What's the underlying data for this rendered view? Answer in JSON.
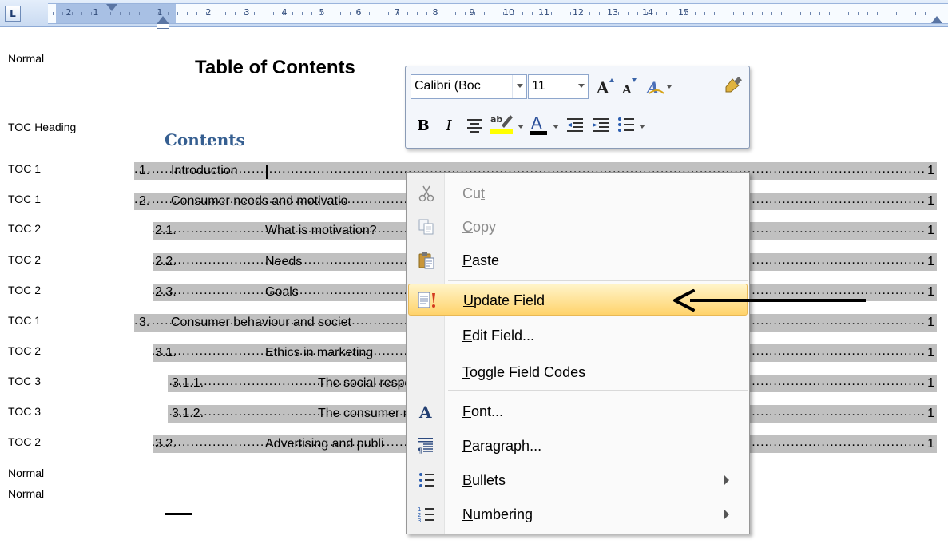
{
  "ruler": {
    "tab_selector": "L",
    "numbers": [
      "2",
      "1",
      "1",
      "2",
      "3",
      "4",
      "5",
      "6",
      "7",
      "8",
      "9",
      "10",
      "11",
      "12",
      "13",
      "14",
      "15"
    ]
  },
  "style_area": {
    "labels": [
      "Normal",
      "TOC Heading",
      "TOC 1",
      "TOC 1",
      "TOC 2",
      "TOC 2",
      "TOC 2",
      "TOC 1",
      "TOC 2",
      "TOC 3",
      "TOC 3",
      "TOC 2",
      "Normal",
      "Normal"
    ]
  },
  "document": {
    "title": "Table of Contents",
    "heading": "Contents",
    "toc": [
      {
        "num": "1.",
        "text": "Introduction",
        "page": "1"
      },
      {
        "num": "2.",
        "text": "Consumer needs and motivatio",
        "page": "1"
      },
      {
        "num": "2.1.",
        "text": "What is motivation?",
        "page": "1"
      },
      {
        "num": "2.2.",
        "text": "Needs",
        "page": "1"
      },
      {
        "num": "2.3.",
        "text": "Goals",
        "page": "1"
      },
      {
        "num": "3.",
        "text": "Consumer behaviour and societ",
        "page": "1"
      },
      {
        "num": "3.1.",
        "text": "Ethics in marketing",
        "page": "1"
      },
      {
        "num": "3.1.1.",
        "text": "The social respo",
        "page": "1"
      },
      {
        "num": "3.1.2.",
        "text": "The consumer m",
        "page": "1"
      },
      {
        "num": "3.2.",
        "text": "Advertising and publi",
        "page": "1"
      }
    ]
  },
  "mini_toolbar": {
    "font_name": "Calibri (Boc",
    "font_size": "11"
  },
  "context_menu": {
    "items": [
      {
        "pre": "Cu",
        "acc": "t",
        "post": "",
        "state": "disabled",
        "icon": "scissors-icon"
      },
      {
        "pre": "",
        "acc": "C",
        "post": "opy",
        "state": "disabled",
        "icon": "copy-icon"
      },
      {
        "pre": "",
        "acc": "P",
        "post": "aste",
        "state": "enabled",
        "icon": "paste-icon"
      },
      {
        "pre": "",
        "acc": "U",
        "post": "pdate Field",
        "state": "hover",
        "icon": "update-field-icon"
      },
      {
        "pre": "",
        "acc": "E",
        "post": "dit Field...",
        "state": "enabled",
        "icon": ""
      },
      {
        "pre": "",
        "acc": "T",
        "post": "oggle Field Codes",
        "state": "enabled",
        "icon": ""
      },
      {
        "pre": "",
        "acc": "F",
        "post": "ont...",
        "state": "enabled",
        "icon": "font-icon"
      },
      {
        "pre": "",
        "acc": "P",
        "post": "aragraph...",
        "state": "enabled",
        "icon": "paragraph-icon"
      },
      {
        "pre": "",
        "acc": "B",
        "post": "ullets",
        "state": "enabled",
        "icon": "bullets-icon"
      },
      {
        "pre": "",
        "acc": "N",
        "post": "umbering",
        "state": "enabled",
        "icon": "numbering-icon"
      }
    ]
  },
  "colors": {
    "toc_shade": "#c0c0c0",
    "heading_blue": "#365f91",
    "hover_gold": "#ffd36b",
    "highlight_yellow": "#ffff00",
    "font_color_bar": "#000000"
  }
}
